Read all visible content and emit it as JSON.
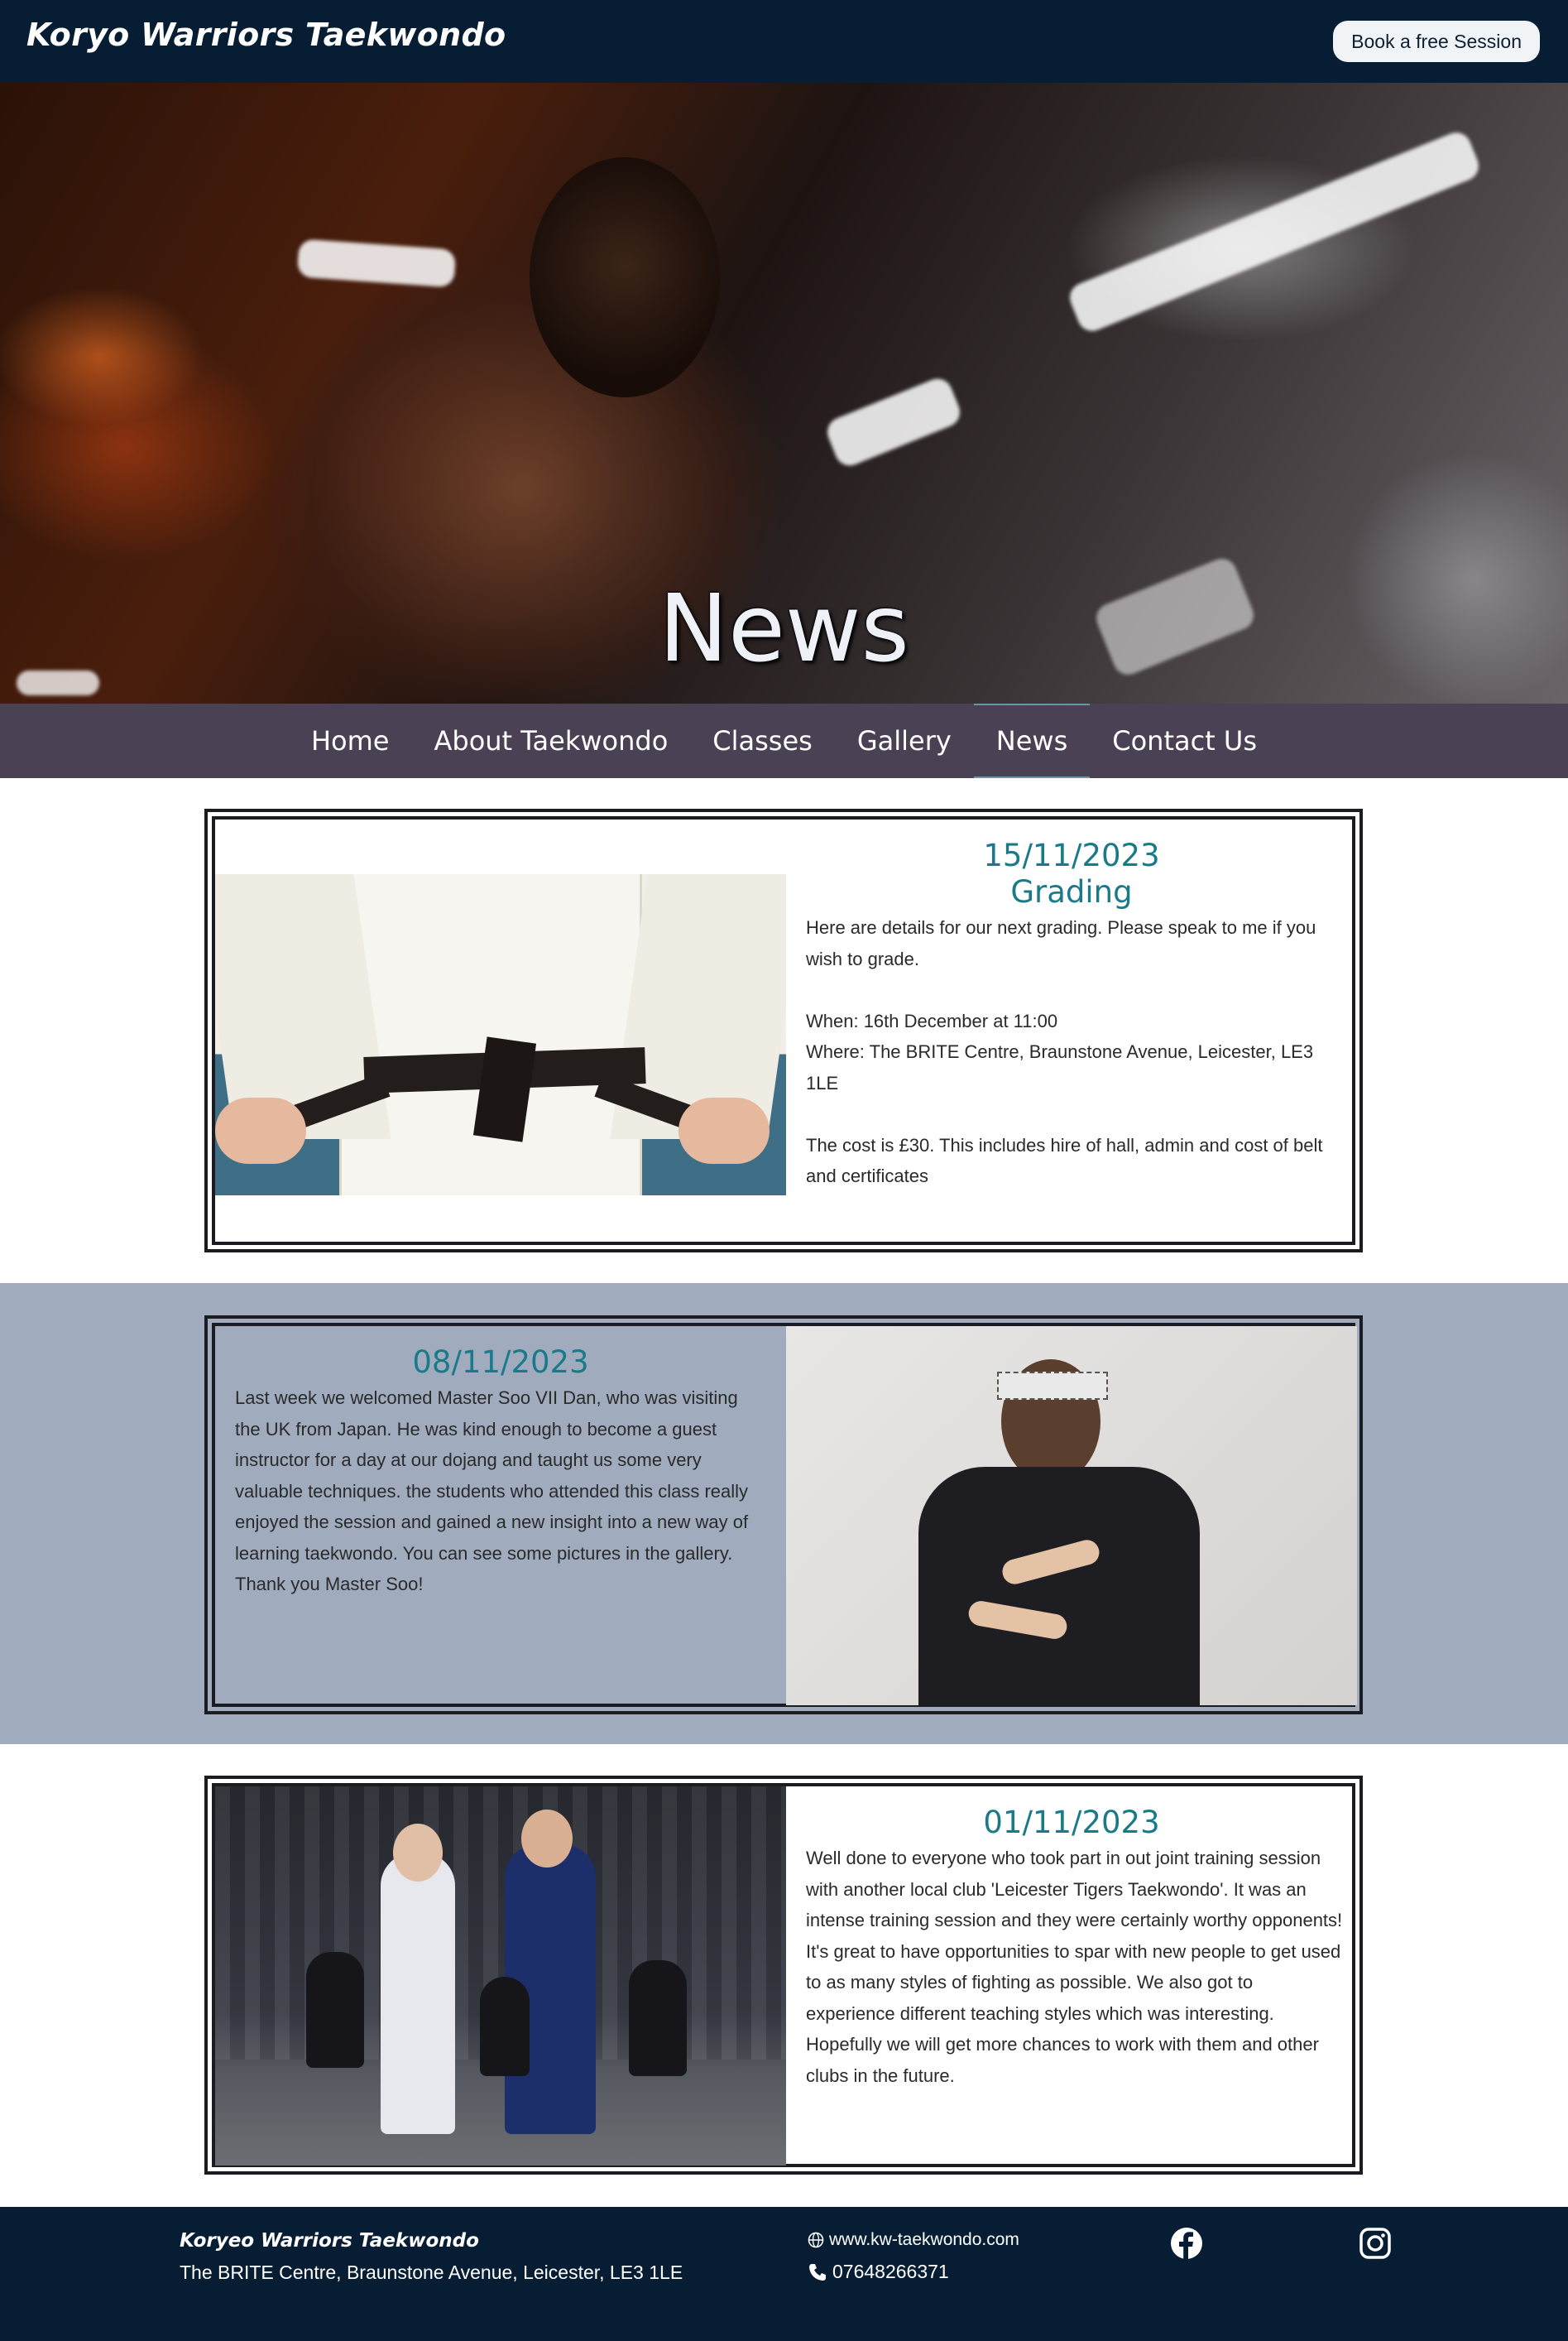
{
  "header": {
    "brand": "Koryo Warriors Taekwondo",
    "cta_label": "Book a free Session"
  },
  "hero": {
    "title": "News"
  },
  "nav": {
    "items": [
      {
        "label": "Home"
      },
      {
        "label": "About Taekwondo"
      },
      {
        "label": "Classes"
      },
      {
        "label": "Gallery"
      },
      {
        "label": "News"
      },
      {
        "label": "Contact Us"
      }
    ],
    "active": "News"
  },
  "articles": [
    {
      "date": "15/11/2023",
      "heading": "Grading",
      "body": "Here are details for our next grading. Please speak to me if you wish to grade.\n\nWhen: 16th December at 11:00\nWhere: The BRITE Centre, Braunstone Avenue, Leicester, LE3 1LE\n\nThe cost is £30. This includes hire of hall, admin and cost of belt and certificates",
      "image": "black-belt-tying-photo"
    },
    {
      "date": "08/11/2023",
      "body": "Last week we welcomed Master Soo VII Dan, who was visiting the UK from Japan. He was kind enough to become a guest instructor for a day at our dojang and taught us some very valuable techniques. the students who attended this class really enjoyed the session and gained a new insight into a new way of learning taekwondo. You can see some pictures in the gallery. Thank you Master Soo!",
      "image": "master-in-black-uniform-photo"
    },
    {
      "date": "01/11/2023",
      "body": "Well done to everyone who took part in out joint training session with another local club 'Leicester Tigers Taekwondo'. It was an intense training session and they were certainly worthy opponents! It's great to have opportunities to spar with new people to get used to as many styles of fighting as possible. We also got to experience different teaching styles which was interesting. Hopefully we will get more chances to work with them and other clubs in the future.",
      "image": "kids-sparring-handshake-photo"
    }
  ],
  "footer": {
    "brand": "Koryeo Warriors Taekwondo",
    "address": "The BRITE Centre, Braunstone Avenue, Leicester, LE3 1LE",
    "website": "www.kw-taekwondo.com",
    "phone": "07648266371",
    "icons": [
      "globe-icon",
      "phone-icon",
      "facebook-icon",
      "instagram-icon"
    ]
  },
  "colors": {
    "header_bg": "#061d33",
    "nav_bg": "#4a4254",
    "accent_teal": "#1b7a8a",
    "grey_band": "#a0acbd"
  }
}
